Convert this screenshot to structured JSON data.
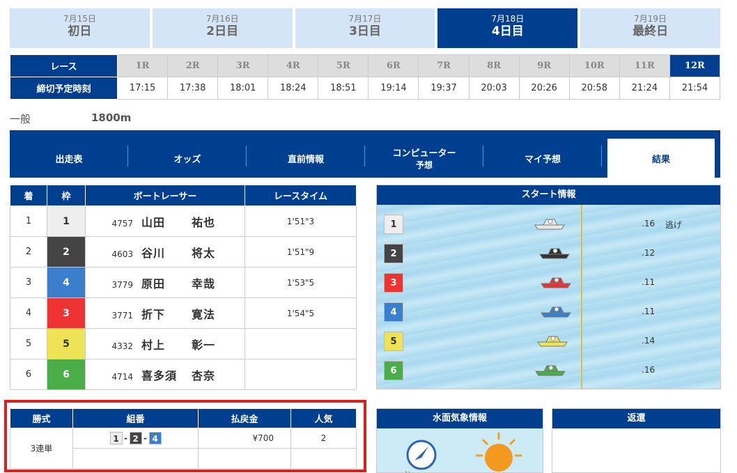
{
  "days": [
    {
      "date": "7月15日",
      "label": "初日",
      "active": false
    },
    {
      "date": "7月16日",
      "label": "2日目",
      "active": false
    },
    {
      "date": "7月17日",
      "label": "3日目",
      "active": false
    },
    {
      "date": "7月18日",
      "label": "4日目",
      "active": true
    },
    {
      "date": "7月19日",
      "label": "最終日",
      "active": false
    }
  ],
  "race_table": {
    "race_header": "レース",
    "time_header": "締切予定時刻",
    "races": [
      "1R",
      "2R",
      "3R",
      "4R",
      "5R",
      "6R",
      "7R",
      "8R",
      "9R",
      "10R",
      "11R",
      "12R"
    ],
    "times": [
      "17:15",
      "17:38",
      "18:01",
      "18:24",
      "18:51",
      "19:14",
      "19:37",
      "20:03",
      "20:26",
      "20:58",
      "21:24",
      "21:54"
    ],
    "active_race": "12R"
  },
  "race_info": {
    "class": "一般",
    "distance": "1800m"
  },
  "nav": {
    "tabs": [
      "出走表",
      "オッズ",
      "直前情報",
      "コンピューター",
      "マイ予想",
      "結果"
    ],
    "computer_sub": "予想",
    "active": "結果"
  },
  "result": {
    "headers": {
      "rank": "着",
      "frame": "枠",
      "racer": "ボートレーサー",
      "time": "レースタイム"
    },
    "rows": [
      {
        "rank": "1",
        "frame": "1",
        "reg": "4757",
        "surname": "山田",
        "given": "祐也",
        "time": "1'51\"3"
      },
      {
        "rank": "2",
        "frame": "2",
        "reg": "4603",
        "surname": "谷川",
        "given": "将太",
        "time": "1'51\"9"
      },
      {
        "rank": "3",
        "frame": "4",
        "reg": "3779",
        "surname": "原田",
        "given": "幸哉",
        "time": "1'53\"5"
      },
      {
        "rank": "4",
        "frame": "3",
        "reg": "3771",
        "surname": "折下",
        "given": "寛法",
        "time": "1'54\"5"
      },
      {
        "rank": "5",
        "frame": "5",
        "reg": "4332",
        "surname": "村上",
        "given": "彰一",
        "time": ""
      },
      {
        "rank": "6",
        "frame": "6",
        "reg": "4714",
        "surname": "喜多須",
        "given": "杏奈",
        "time": ""
      }
    ]
  },
  "start_info": {
    "title": "スタート情報",
    "rows": [
      {
        "frame": "1",
        "st": ".16",
        "note": "逃げ",
        "color": "#e8e8e8"
      },
      {
        "frame": "2",
        "st": ".12",
        "note": "",
        "color": "#333333"
      },
      {
        "frame": "3",
        "st": ".11",
        "note": "",
        "color": "#e33333"
      },
      {
        "frame": "4",
        "st": ".11",
        "note": "",
        "color": "#3b7fcc"
      },
      {
        "frame": "5",
        "st": ".14",
        "note": "",
        "color": "#eee355"
      },
      {
        "frame": "6",
        "st": ".16",
        "note": "",
        "color": "#4aad47"
      }
    ]
  },
  "payout": {
    "headers": {
      "type": "勝式",
      "combo": "組番",
      "amount": "払戻金",
      "popularity": "人気"
    },
    "type": "3連単",
    "combo": [
      "1",
      "2",
      "4"
    ],
    "amount": "¥700",
    "popularity": "2"
  },
  "weather": {
    "title": "水面気象情報"
  },
  "refund": {
    "title": "返還"
  }
}
